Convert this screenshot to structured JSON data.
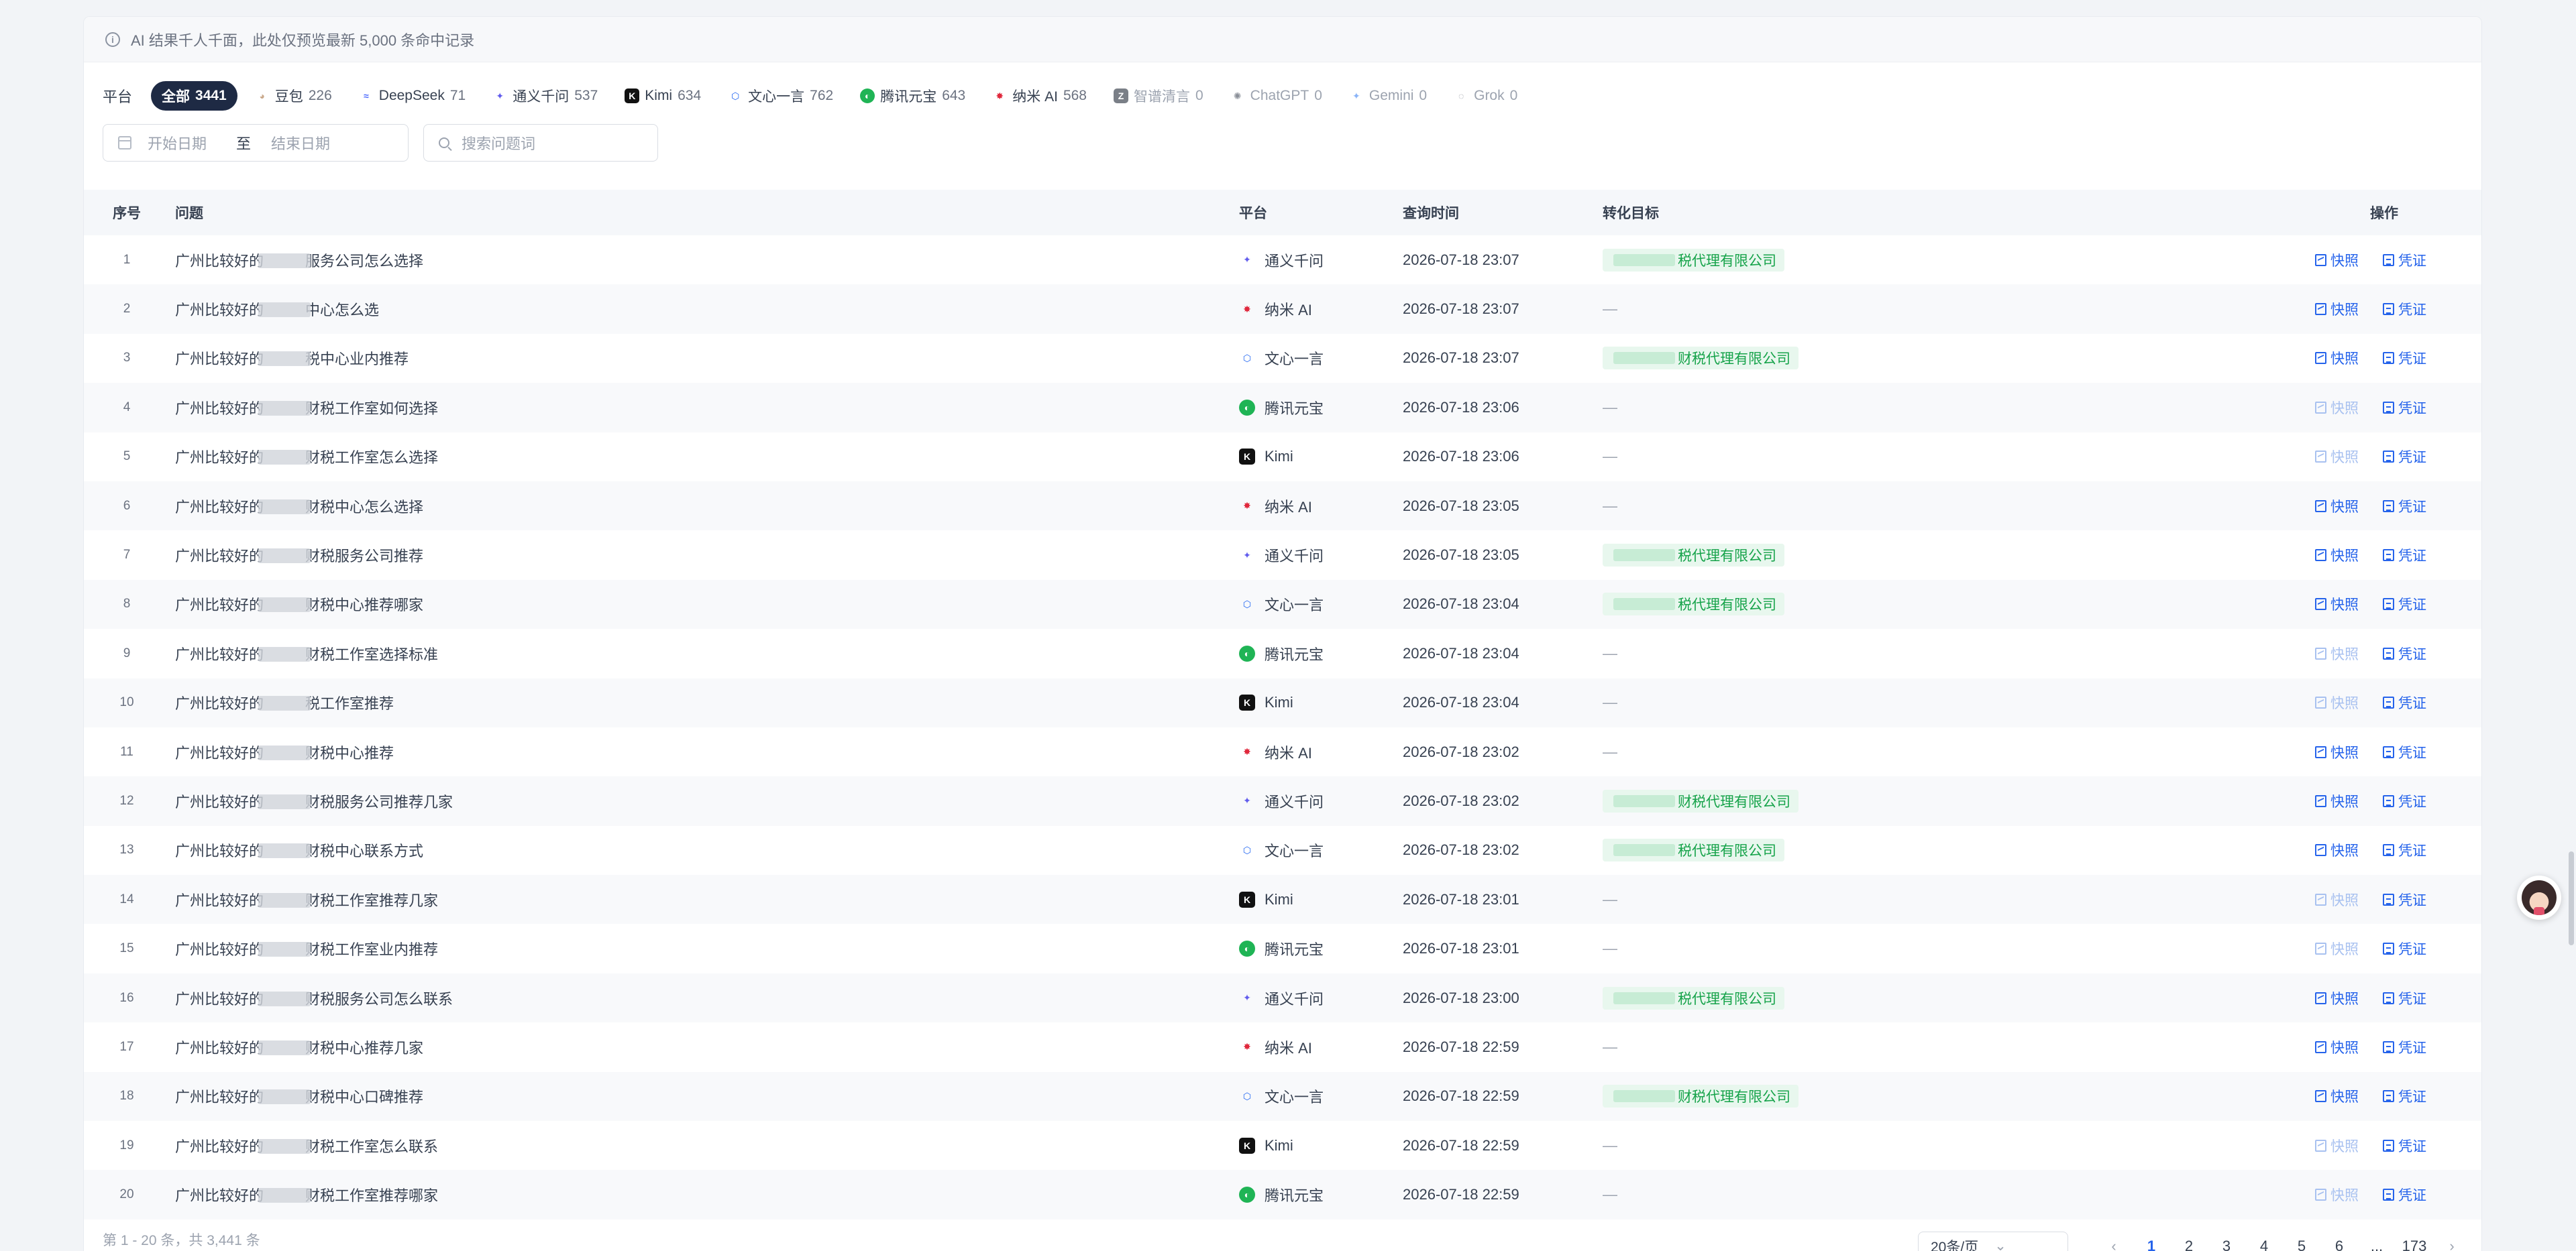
{
  "notice": {
    "text": "AI 结果千人千面，此处仅预览最新 5,000 条命中记录"
  },
  "filters": {
    "platform_label": "平台",
    "platforms": [
      {
        "name": "全部",
        "count": "3441",
        "icon": "",
        "color": "#1e2a44",
        "state": "active"
      },
      {
        "name": "豆包",
        "count": "226",
        "icon": "doubao-icon",
        "color": "#c9a88a",
        "state": "normal"
      },
      {
        "name": "DeepSeek",
        "count": "71",
        "icon": "deepseek-icon",
        "color": "#4d6bfe",
        "state": "normal"
      },
      {
        "name": "通义千问",
        "count": "537",
        "icon": "tongyi-icon",
        "color": "#615ced",
        "state": "normal"
      },
      {
        "name": "Kimi",
        "count": "634",
        "icon": "kimi-icon",
        "color": "#111111",
        "state": "normal"
      },
      {
        "name": "文心一言",
        "count": "762",
        "icon": "wenxin-icon",
        "color": "#2468f2",
        "state": "normal"
      },
      {
        "name": "腾讯元宝",
        "count": "643",
        "icon": "yuanbao-icon",
        "color": "#1fb455",
        "state": "normal"
      },
      {
        "name": "纳米 AI",
        "count": "568",
        "icon": "nami-icon",
        "color": "#e0283c",
        "state": "normal"
      },
      {
        "name": "智谱清言",
        "count": "0",
        "icon": "zhipu-icon",
        "color": "#7a7f87",
        "state": "disabled"
      },
      {
        "name": "ChatGPT",
        "count": "0",
        "icon": "chatgpt-icon",
        "color": "#8a8f98",
        "state": "disabled"
      },
      {
        "name": "Gemini",
        "count": "0",
        "icon": "gemini-icon",
        "color": "#8ab4f8",
        "state": "disabled"
      },
      {
        "name": "Grok",
        "count": "0",
        "icon": "grok-icon",
        "color": "#8a8f98",
        "state": "disabled"
      }
    ],
    "start_date_placeholder": "开始日期",
    "date_separator": "至",
    "end_date_placeholder": "结束日期",
    "search_placeholder": "搜索问题词"
  },
  "table": {
    "headers": {
      "no": "序号",
      "question": "问题",
      "platform": "平台",
      "time": "查询时间",
      "target": "转化目标",
      "action": "操作"
    },
    "snapshot_label": "快照",
    "voucher_label": "凭证",
    "rows": [
      {
        "no": "1",
        "q_prefix": "广州比较好的",
        "q_suffix": "服务公司怎么选择",
        "platform": "通义千问",
        "time": "2026-07-18 23:07",
        "target": "税代理有限公司",
        "snapshot_enabled": true
      },
      {
        "no": "2",
        "q_prefix": "广州比较好的",
        "q_suffix": "中心怎么选",
        "platform": "纳米 AI",
        "time": "2026-07-18 23:07",
        "target": "",
        "snapshot_enabled": true
      },
      {
        "no": "3",
        "q_prefix": "广州比较好的",
        "q_suffix": "税中心业内推荐",
        "platform": "文心一言",
        "time": "2026-07-18 23:07",
        "target": "财税代理有限公司",
        "snapshot_enabled": true
      },
      {
        "no": "4",
        "q_prefix": "广州比较好的",
        "q_suffix": "财税工作室如何选择",
        "platform": "腾讯元宝",
        "time": "2026-07-18 23:06",
        "target": "",
        "snapshot_enabled": false
      },
      {
        "no": "5",
        "q_prefix": "广州比较好的",
        "q_suffix": "财税工作室怎么选择",
        "platform": "Kimi",
        "time": "2026-07-18 23:06",
        "target": "",
        "snapshot_enabled": false
      },
      {
        "no": "6",
        "q_prefix": "广州比较好的",
        "q_suffix": "财税中心怎么选择",
        "platform": "纳米 AI",
        "time": "2026-07-18 23:05",
        "target": "",
        "snapshot_enabled": true
      },
      {
        "no": "7",
        "q_prefix": "广州比较好的",
        "q_suffix": "财税服务公司推荐",
        "platform": "通义千问",
        "time": "2026-07-18 23:05",
        "target": "税代理有限公司",
        "snapshot_enabled": true
      },
      {
        "no": "8",
        "q_prefix": "广州比较好的",
        "q_suffix": "财税中心推荐哪家",
        "platform": "文心一言",
        "time": "2026-07-18 23:04",
        "target": "税代理有限公司",
        "snapshot_enabled": true
      },
      {
        "no": "9",
        "q_prefix": "广州比较好的",
        "q_suffix": "财税工作室选择标准",
        "platform": "腾讯元宝",
        "time": "2026-07-18 23:04",
        "target": "",
        "snapshot_enabled": false
      },
      {
        "no": "10",
        "q_prefix": "广州比较好的",
        "q_suffix": "税工作室推荐",
        "platform": "Kimi",
        "time": "2026-07-18 23:04",
        "target": "",
        "snapshot_enabled": false
      },
      {
        "no": "11",
        "q_prefix": "广州比较好的",
        "q_suffix": "财税中心推荐",
        "platform": "纳米 AI",
        "time": "2026-07-18 23:02",
        "target": "",
        "snapshot_enabled": true
      },
      {
        "no": "12",
        "q_prefix": "广州比较好的",
        "q_suffix": "财税服务公司推荐几家",
        "platform": "通义千问",
        "time": "2026-07-18 23:02",
        "target": "财税代理有限公司",
        "snapshot_enabled": true
      },
      {
        "no": "13",
        "q_prefix": "广州比较好的",
        "q_suffix": "财税中心联系方式",
        "platform": "文心一言",
        "time": "2026-07-18 23:02",
        "target": "税代理有限公司",
        "snapshot_enabled": true
      },
      {
        "no": "14",
        "q_prefix": "广州比较好的",
        "q_suffix": "财税工作室推荐几家",
        "platform": "Kimi",
        "time": "2026-07-18 23:01",
        "target": "",
        "snapshot_enabled": false
      },
      {
        "no": "15",
        "q_prefix": "广州比较好的",
        "q_suffix": "财税工作室业内推荐",
        "platform": "腾讯元宝",
        "time": "2026-07-18 23:01",
        "target": "",
        "snapshot_enabled": false
      },
      {
        "no": "16",
        "q_prefix": "广州比较好的",
        "q_suffix": "财税服务公司怎么联系",
        "platform": "通义千问",
        "time": "2026-07-18 23:00",
        "target": "税代理有限公司",
        "snapshot_enabled": true
      },
      {
        "no": "17",
        "q_prefix": "广州比较好的",
        "q_suffix": "财税中心推荐几家",
        "platform": "纳米 AI",
        "time": "2026-07-18 22:59",
        "target": "",
        "snapshot_enabled": true
      },
      {
        "no": "18",
        "q_prefix": "广州比较好的",
        "q_suffix": "财税中心口碑推荐",
        "platform": "文心一言",
        "time": "2026-07-18 22:59",
        "target": "财税代理有限公司",
        "snapshot_enabled": true
      },
      {
        "no": "19",
        "q_prefix": "广州比较好的",
        "q_suffix": "财税工作室怎么联系",
        "platform": "Kimi",
        "time": "2026-07-18 22:59",
        "target": "",
        "snapshot_enabled": false
      },
      {
        "no": "20",
        "q_prefix": "广州比较好的",
        "q_suffix": "财税工作室推荐哪家",
        "platform": "腾讯元宝",
        "time": "2026-07-18 22:59",
        "target": "",
        "snapshot_enabled": false
      }
    ]
  },
  "footer": {
    "total": "第 1 - 20 条，共 3,441 条",
    "page_size": "20条/页",
    "pages": [
      "1",
      "2",
      "3",
      "4",
      "5",
      "6",
      "...",
      "173"
    ],
    "current_page": "1"
  },
  "colors": {
    "accent": "#2563eb",
    "target_green": "#16a34a",
    "active_chip": "#1e2a44"
  }
}
